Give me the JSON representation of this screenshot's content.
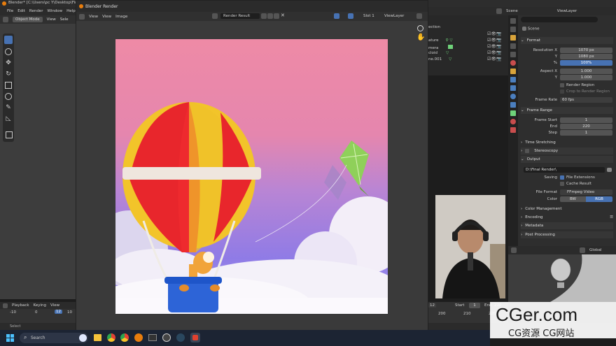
{
  "titlebar": {
    "title": "Blender* [C:\\Users\\pc Y\\Desktop\\Final S"
  },
  "menu": [
    "File",
    "Edit",
    "Render",
    "Window",
    "Help"
  ],
  "viewport_header": {
    "mode": "Object Mode",
    "view": "View",
    "select": "Sele"
  },
  "render_window": {
    "title": "Blender Render",
    "menu": [
      "View",
      "View",
      "Image"
    ],
    "image_name": "Render Result",
    "slot": "Slot 1",
    "view_layer": "ViewLayer"
  },
  "top_right": {
    "scene": "Scene",
    "view_layer": "ViewLayer"
  },
  "outliner": {
    "items": [
      "ection",
      "ature",
      "mera",
      "cloid",
      "ne.001"
    ]
  },
  "properties": {
    "scene_label": "Scene",
    "format": {
      "header": "Format",
      "res_x_label": "Resolution X",
      "res_x": "1070 px",
      "res_y_label": "Y",
      "res_y": "1080 px",
      "pct_label": "%",
      "pct": "100%",
      "aspect_x_label": "Aspect X",
      "aspect_x": "1.000",
      "aspect_y_label": "Y",
      "aspect_y": "1.000",
      "render_region": "Render Region",
      "crop_region": "Crop to Render Region",
      "frame_rate_label": "Frame Rate",
      "frame_rate": "60 fps"
    },
    "frame_range": {
      "header": "Frame Range",
      "start_label": "Frame Start",
      "start": "1",
      "end_label": "End",
      "end": "220",
      "step_label": "Step",
      "step": "1"
    },
    "time_stretching": "Time Stretching",
    "stereoscopy": "Stereoscopy",
    "output": {
      "header": "Output",
      "path": "D:\\Final Render\\",
      "saving_label": "Saving",
      "file_ext": "File Extensions",
      "cache_result": "Cache Result",
      "file_format_label": "File Format",
      "file_format": "FFmpeg Video",
      "color_label": "Color",
      "bw": "BW",
      "rgb": "RGB"
    },
    "color_management": "Color Management",
    "encoding": "Encoding",
    "metadata": "Metadata",
    "post_processing": "Post Processing"
  },
  "viewport_small": {
    "global": "Global"
  },
  "timeline": {
    "menu": [
      "Playback",
      "Keying",
      "View"
    ],
    "frame_current": "12",
    "ticks": [
      "-10",
      "0",
      "10"
    ],
    "right_start_label": "Start",
    "right_start": "1",
    "right_end_label": "End",
    "right_end": "220",
    "right_ticks": [
      "12",
      "200",
      "210",
      "220"
    ],
    "status": "Select"
  },
  "taskbar": {
    "search": "Search"
  },
  "watermark": {
    "main": "CGer.com",
    "sub": "CG资源 CG网站"
  }
}
